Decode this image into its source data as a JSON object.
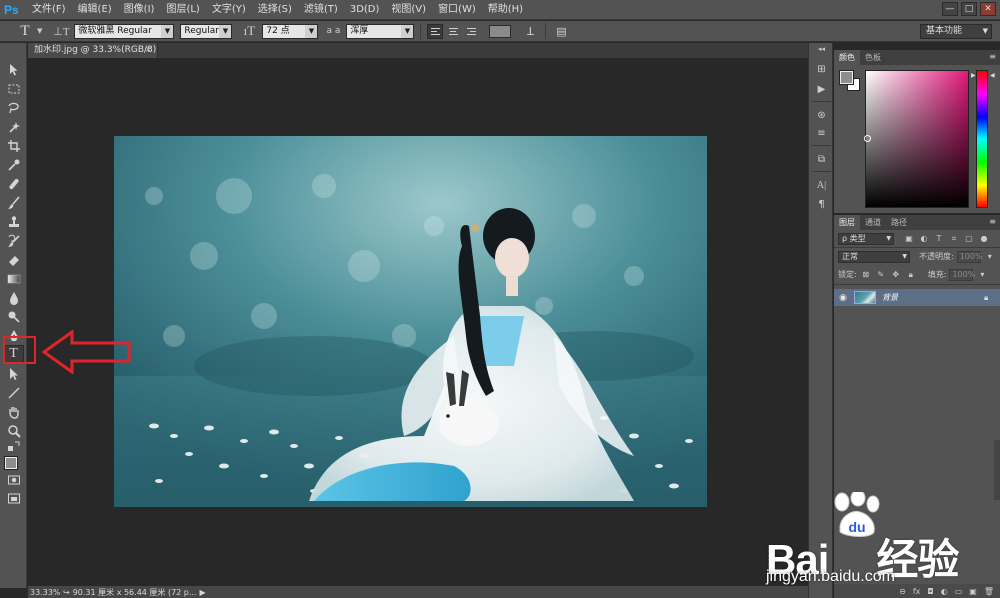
{
  "app": {
    "logo": "Ps",
    "menu": [
      "文件(F)",
      "编辑(E)",
      "图像(I)",
      "图层(L)",
      "文字(Y)",
      "选择(S)",
      "滤镜(T)",
      "3D(D)",
      "视图(V)",
      "窗口(W)",
      "帮助(H)"
    ],
    "window_controls": [
      "—",
      "□",
      "✕"
    ]
  },
  "options": {
    "font_family": "微软雅黑 Regular",
    "font_style": "Regular",
    "font_size": "72 点",
    "aa_label": "a a",
    "aa_method": "浑厚",
    "workspace": "基本功能"
  },
  "document": {
    "tab_title": "加水印.jpg @ 33.3%(RGB/8)",
    "close_glyph": "×"
  },
  "status": {
    "zoom": "33.33%",
    "doc_info": "90.31 厘米 x 56.44 厘米 (72 p..."
  },
  "panels": {
    "color_tabs": [
      "颜色",
      "色板"
    ],
    "layers_tabs": [
      "图层",
      "通道",
      "路径"
    ],
    "filter_kind": "ρ 类型",
    "blend_mode": "正常",
    "opacity_label": "不透明度:",
    "opacity_value": "100%",
    "lock_label": "锁定:",
    "fill_label": "填充:",
    "fill_value": "100%",
    "layer_name": "背景"
  },
  "watermark": {
    "brand": "Bai",
    "brand_tail": "经验",
    "url": "jingyan.baidu.com"
  },
  "colors": {
    "annotation": "#e0242b",
    "selected_layer": "#5d6f87",
    "panel_bg": "#535353"
  }
}
